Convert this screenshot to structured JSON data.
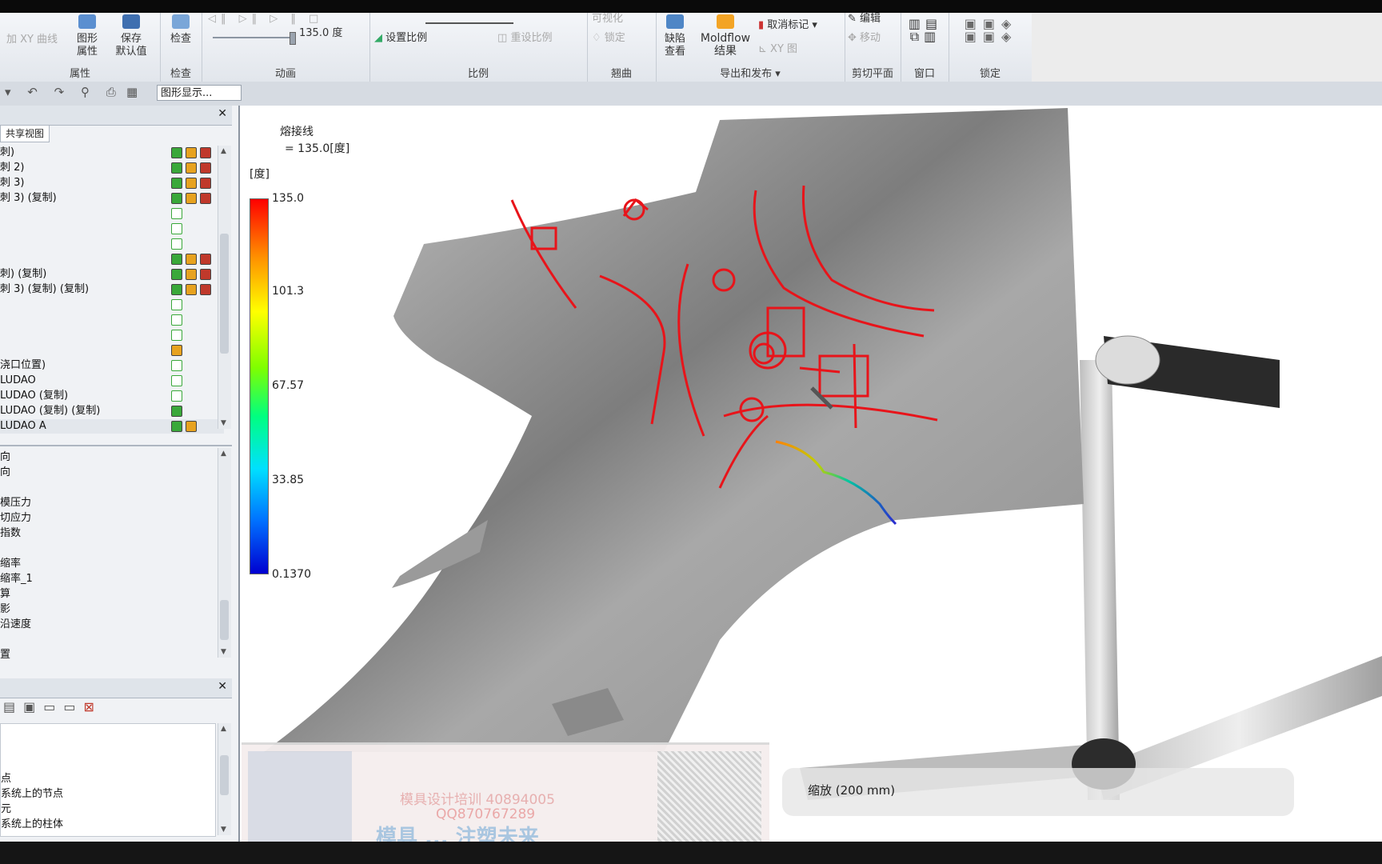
{
  "ribbon": {
    "groups": [
      {
        "title": "属性",
        "items": [
          "加 XY 曲线",
          "图形\n属性",
          "保存\n默认值"
        ]
      },
      {
        "title": "检查",
        "items": [
          "检查"
        ]
      },
      {
        "title": "动画",
        "items": [
          "135.0 度"
        ]
      },
      {
        "title": "比例",
        "items": [
          "设置比例",
          "重设比例"
        ]
      },
      {
        "title": "翘曲",
        "items": [
          "可视化",
          "锁定"
        ]
      },
      {
        "title": "导出和发布 ▾",
        "items": [
          "缺陷\n查看",
          "Moldflow\n结果",
          "取消标记 ▾",
          "XY 图"
        ]
      },
      {
        "title": "剪切平面",
        "items": [
          "编辑",
          "移动"
        ]
      },
      {
        "title": "窗口",
        "items": []
      },
      {
        "title": "锁定",
        "items": []
      }
    ]
  },
  "qat": {
    "combo_value": "图形显示..."
  },
  "left_panel": {
    "tab_label": "共享视图",
    "layers": [
      "刺)",
      "刺 2)",
      "刺 3)",
      "刺 3) (复制)",
      "",
      "",
      "",
      "",
      "刺) (复制)",
      "刺 3) (复制) (复制)",
      "",
      "",
      "",
      "",
      "浇口位置)",
      "LUDAO",
      "LUDAO (复制)",
      "LUDAO (复制) (复制)",
      "LUDAO A"
    ],
    "results": [
      "向",
      "向",
      "",
      "模压力",
      "切应力",
      "指数",
      "",
      "缩率",
      "缩率_1",
      "算",
      "影",
      "沿速度",
      "",
      "置"
    ],
    "bottom_items": [
      "",
      "",
      "",
      "点",
      "系统上的节点",
      "元",
      "系统上的柱体"
    ]
  },
  "viewport": {
    "legend_title": "熔接线",
    "legend_value": "= 135.0[度]",
    "legend_unit": "[度]",
    "ticks": [
      "135.0",
      "101.3",
      "67.57",
      "33.85",
      "0.1370"
    ],
    "scale_label": "缩放 (200 mm)"
  },
  "ad": {
    "line1": "模具设计培训 40894005",
    "line2": "QQ870767289",
    "line3": "模具 ... 注塑未来"
  }
}
